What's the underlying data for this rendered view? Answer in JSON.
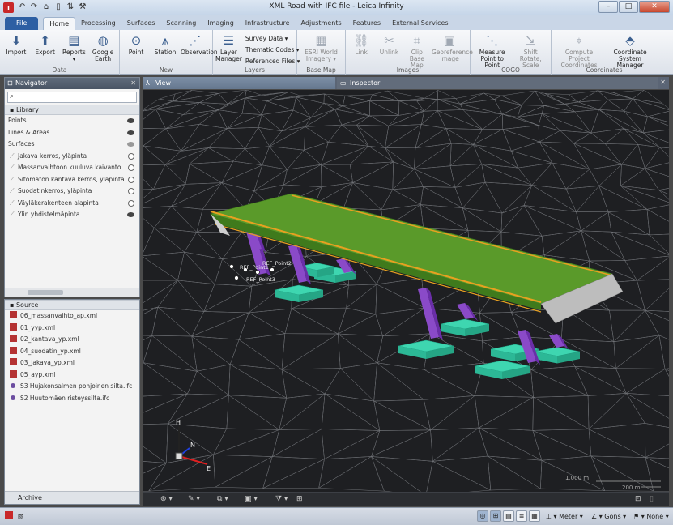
{
  "window": {
    "title": "XML Road with IFC file - Leica Infinity",
    "controls": {
      "minimize": "–",
      "maximize": "□",
      "close": "✕"
    }
  },
  "quick_access": [
    "↶",
    "↷",
    "⌂",
    "▯",
    "⇅",
    "⚒"
  ],
  "ribbon_tabs": [
    {
      "label": "File"
    },
    {
      "label": "Home"
    },
    {
      "label": "Processing"
    },
    {
      "label": "Surfaces"
    },
    {
      "label": "Scanning"
    },
    {
      "label": "Imaging"
    },
    {
      "label": "Infrastructure"
    },
    {
      "label": "Adjustments"
    },
    {
      "label": "Features"
    },
    {
      "label": "External Services"
    }
  ],
  "ribbon": {
    "data": {
      "label": "Data",
      "import": "Import",
      "export": "Export",
      "reports": "Reports",
      "google_earth": "Google Earth"
    },
    "new": {
      "label": "New",
      "point": "Point",
      "station": "Station",
      "observation": "Observation"
    },
    "layers": {
      "label": "Layers",
      "layer_manager": "Layer Manager",
      "survey_data": "Survey Data",
      "thematic_codes": "Thematic Codes",
      "referenced_files": "Referenced Files"
    },
    "base_map": {
      "label": "Base Map",
      "esri": "ESRI World Imagery"
    },
    "images": {
      "label": "Images",
      "link": "Link",
      "unlink": "Unlink",
      "clip": "Clip Base Map",
      "georeference": "Georeference Image"
    },
    "cogo": {
      "label": "COGO",
      "measure": "Measure Point to Point",
      "shift": "Shift Rotate, Scale"
    },
    "coordinates": {
      "label": "Coordinates",
      "compute": "Compute Project Coordinates",
      "csm": "Coordinate System Manager"
    }
  },
  "navigator": {
    "title": "Navigator",
    "search_placeholder": "",
    "library_label": "Library",
    "items": [
      {
        "label": "Points",
        "visible": "eye"
      },
      {
        "label": "Lines & Areas",
        "visible": "eye"
      },
      {
        "label": "Surfaces",
        "visible": "eye-dim"
      }
    ],
    "surfaces": [
      {
        "label": "Jakava kerros, yläpinta"
      },
      {
        "label": "Massanvaihtoon kuuluva kaivanto"
      },
      {
        "label": "Sitomaton kantava kerros, yläpinta"
      },
      {
        "label": "Suodatinkerros, yläpinta"
      },
      {
        "label": "Väyläkerakenteen alapinta"
      },
      {
        "label": "Ylin yhdistelmäpinta"
      }
    ]
  },
  "source": {
    "title": "Source",
    "files": [
      {
        "label": "06_massanvaihto_ap.xml",
        "type": "xml"
      },
      {
        "label": "01_yyp.xml",
        "type": "xml"
      },
      {
        "label": "02_kantava_yp.xml",
        "type": "xml"
      },
      {
        "label": "04_suodatin_yp.xml",
        "type": "xml"
      },
      {
        "label": "03_jakava_yp.xml",
        "type": "xml"
      },
      {
        "label": "05_ayp.xml",
        "type": "xml"
      },
      {
        "label": "S3 Hujakonsalmen pohjoinen silta.ifc",
        "type": "ifc"
      },
      {
        "label": "S2 Huutomäen risteyssilta.ifc",
        "type": "ifc"
      }
    ],
    "archive_label": "Archive"
  },
  "doc_tabs": {
    "view": "View",
    "inspector": "Inspector"
  },
  "viewport": {
    "axis": {
      "h": "H",
      "n": "N",
      "e": "E"
    },
    "scale_top": "1,000 m",
    "scale_bottom": "200 m",
    "point_labels": [
      "REF_Point1",
      "REF_Point2",
      "REF_Point3"
    ],
    "colors": {
      "deck": "#5a9a2a",
      "edge": "#e8a020",
      "pier": "#8a4ac8",
      "footing": "#3ed6b0",
      "mesh": "#8a8d92"
    }
  },
  "statusbar": {
    "units_distance": "Meter",
    "units_angle": "Gons",
    "units_other": "None"
  }
}
